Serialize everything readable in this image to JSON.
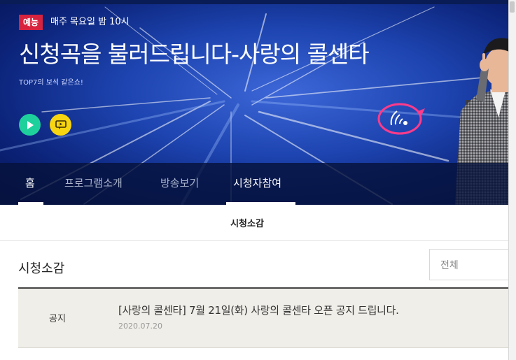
{
  "show": {
    "genre_badge": "예능",
    "schedule": "매주 목요일 밤 10시",
    "title": "신청곡을 불러드립니다-사랑의 콜센타",
    "subtitle": "TOP7의 보석 같은쇼!"
  },
  "icons": {
    "play": "play-icon",
    "chat": "chat-icon",
    "logo": "phone-wave-logo-icon"
  },
  "colors": {
    "genre_badge": "#d8233f",
    "play_button": "#1ed09c",
    "chat_button": "#f7d511",
    "hero_blue": "#1d44b0"
  },
  "nav": {
    "items": [
      {
        "label": "홈",
        "active": true
      },
      {
        "label": "프로그램소개",
        "active": false
      },
      {
        "label": "방송보기",
        "active": false
      },
      {
        "label": "시청자참여",
        "active": true
      }
    ]
  },
  "page": {
    "header": "시청소감",
    "section_title": "시청소감",
    "filter_value": "전체"
  },
  "board": {
    "rows": [
      {
        "label": "공지",
        "title": "[사랑의 콜센타] 7월 21일(화) 사랑의 콜센타 오픈 공지 드립니다.",
        "date": "2020.07.20"
      }
    ]
  }
}
